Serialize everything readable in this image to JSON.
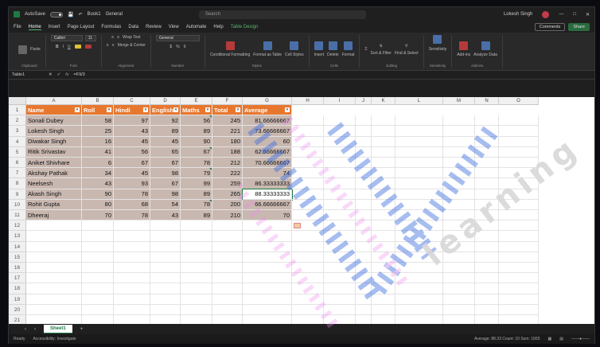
{
  "titlebar": {
    "autosave_label": "AutoSave",
    "toggle_state": "Off",
    "book_title": "Book1",
    "sensitivity": "General",
    "search_placeholder": "Search",
    "user_name": "Lokesh Singh"
  },
  "tabs": [
    "File",
    "Home",
    "Insert",
    "Page Layout",
    "Formulas",
    "Data",
    "Review",
    "View",
    "Automate",
    "Help",
    "Table Design"
  ],
  "active_tab": "Home",
  "ribbon_buttons": {
    "comments": "Comments",
    "share": "Share"
  },
  "ribbon": {
    "paste": "Paste",
    "font_name": "Calibri",
    "font_size": "11",
    "wrap_text": "Wrap Text",
    "merge_center": "Merge & Center",
    "number_format": "General",
    "conditional": "Conditional Formatting",
    "format_table": "Format as Table",
    "cell_styles": "Cell Styles",
    "insert": "Insert",
    "delete": "Delete",
    "format": "Format",
    "sort_filter": "Sort & Filter",
    "find_select": "Find & Select",
    "sensitivity": "Sensitivity",
    "addins": "Add-ins",
    "analyze": "Analyze Data",
    "groups": [
      "Clipboard",
      "Font",
      "Alignment",
      "Number",
      "Styles",
      "Cells",
      "Editing",
      "Sensitivity",
      "Add-ins"
    ]
  },
  "formula_bar": {
    "name_box": "Table1",
    "fx": "fx",
    "formula": "=F9/3"
  },
  "columns": [
    "A",
    "B",
    "C",
    "D",
    "E",
    "F",
    "G",
    "H",
    "I",
    "J",
    "K",
    "L",
    "M",
    "N",
    "O"
  ],
  "rows": [
    "1",
    "2",
    "3",
    "4",
    "5",
    "6",
    "7",
    "8",
    "9",
    "10",
    "11",
    "12",
    "13",
    "14",
    "15",
    "16",
    "17",
    "18",
    "19",
    "20",
    "21"
  ],
  "table": {
    "headers": [
      "Name",
      "Roll",
      "Hindi",
      "English",
      "Maths",
      "Total",
      "Average"
    ],
    "data": [
      [
        "Sonali Dubey",
        "58",
        "97",
        "92",
        "56",
        "245",
        "81.66666667"
      ],
      [
        "Lokesh Singh",
        "25",
        "43",
        "89",
        "89",
        "221",
        "73.66666667"
      ],
      [
        "Diwakar Singh",
        "16",
        "45",
        "45",
        "90",
        "180",
        "60"
      ],
      [
        "Ritik Srivastav",
        "41",
        "56",
        "65",
        "67",
        "188",
        "62.66666667"
      ],
      [
        "Aniket Shivhare",
        "6",
        "67",
        "67",
        "78",
        "212",
        "70.66666667"
      ],
      [
        "Akshay Pathak",
        "34",
        "45",
        "98",
        "79",
        "222",
        "74"
      ],
      [
        "Neelsesh",
        "43",
        "93",
        "67",
        "99",
        "259",
        "86.33333333"
      ],
      [
        "Akash Singh",
        "90",
        "78",
        "98",
        "89",
        "265",
        "88.33333333"
      ],
      [
        "Rohit Gupta",
        "80",
        "68",
        "54",
        "78",
        "200",
        "66.66666667"
      ],
      [
        "Dheeraj",
        "70",
        "78",
        "43",
        "89",
        "210",
        "70"
      ]
    ]
  },
  "sheet_tab": "Sheet1",
  "status": {
    "ready": "Ready",
    "accessibility": "Accessibility: Investigate",
    "stats": "Average: 88.33   Count: 10   Sum: 1665"
  },
  "watermark_text": "learning"
}
